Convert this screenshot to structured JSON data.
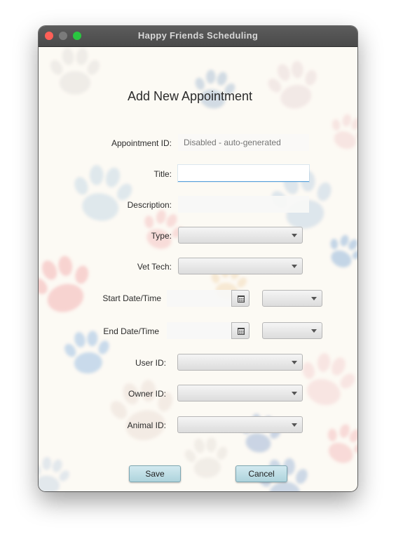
{
  "window": {
    "title": "Happy Friends Scheduling"
  },
  "form": {
    "heading": "Add New Appointment",
    "appointment_id": {
      "label": "Appointment ID:",
      "placeholder": "Disabled - auto-generated",
      "disabled": true
    },
    "title": {
      "label": "Title:",
      "value": ""
    },
    "description": {
      "label": "Description:",
      "value": ""
    },
    "type": {
      "label": "Type:",
      "selected": ""
    },
    "vet_tech": {
      "label": "Vet Tech:",
      "selected": ""
    },
    "start": {
      "label": "Start Date/Time",
      "date": "",
      "time": ""
    },
    "end": {
      "label": "End Date/Time",
      "date": "",
      "time": ""
    },
    "user_id": {
      "label": "User ID:",
      "selected": ""
    },
    "owner_id": {
      "label": "Owner ID:",
      "selected": ""
    },
    "animal_id": {
      "label": "Animal ID:",
      "selected": ""
    }
  },
  "buttons": {
    "save": "Save",
    "cancel": "Cancel"
  },
  "icons": {
    "calendar": "calendar-icon",
    "dropdown": "chevron-down-icon",
    "background": "paw-print-icon"
  },
  "colors": {
    "button_face": "#aed3dc",
    "focus_underline": "#5aa3dc",
    "close": "#ff5f57",
    "maximize": "#29c740"
  }
}
